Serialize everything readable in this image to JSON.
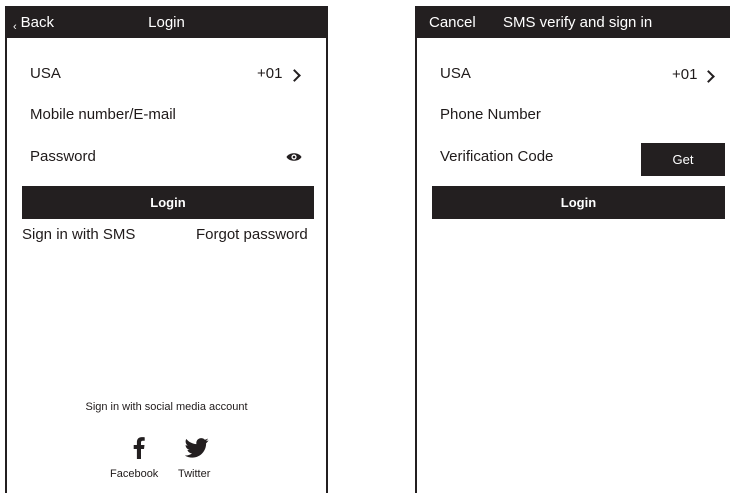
{
  "login_screen": {
    "header": {
      "back_label": "Back",
      "back_chevron": "‹",
      "title": "Login"
    },
    "country": "USA",
    "country_code": "+01",
    "mobile_placeholder": "Mobile number/E-mail",
    "password_placeholder": "Password",
    "login_button": "Login",
    "sms_link": "Sign in with SMS",
    "forgot_link": "Forgot password",
    "social_caption": "Sign in with social media account",
    "social": [
      {
        "label": "Facebook",
        "icon": "facebook-icon"
      },
      {
        "label": "Twitter",
        "icon": "twitter-icon"
      }
    ]
  },
  "sms_screen": {
    "header": {
      "cancel_label": "Cancel",
      "title": "SMS verify and sign in"
    },
    "country": "USA",
    "country_code": "+01",
    "phone_placeholder": "Phone Number",
    "code_placeholder": "Verification Code",
    "get_button": "Get",
    "login_button": "Login"
  },
  "colors": {
    "dark": "#231f20",
    "background": "#ffffff"
  }
}
